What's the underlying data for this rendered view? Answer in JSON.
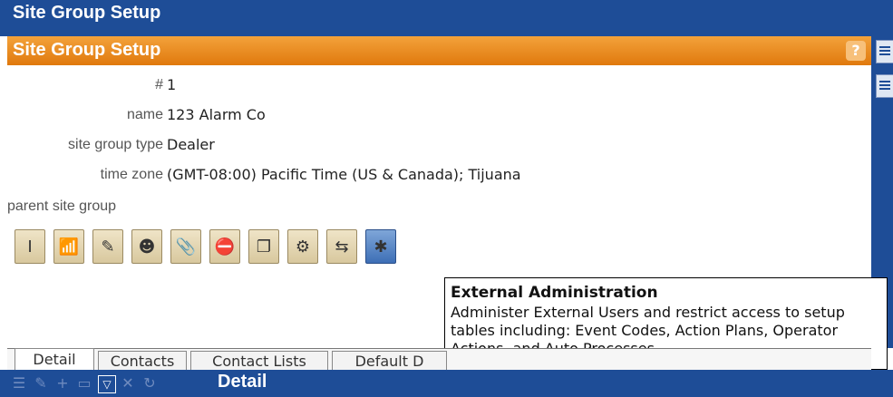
{
  "window": {
    "title": "Site Group Setup"
  },
  "panel": {
    "title": "Site Group Setup",
    "help_icon": "help-icon",
    "help_text": "?"
  },
  "fields": {
    "number": {
      "label": "#",
      "value": "1"
    },
    "name": {
      "label": "name",
      "value": "123 Alarm Co"
    },
    "site_group_type": {
      "label": "site group type",
      "value": "Dealer"
    },
    "time_zone": {
      "label": "time zone",
      "value": "(GMT-08:00) Pacific Time (US & Canada); Tijuana"
    },
    "parent_site_group": {
      "label": "parent site group",
      "value": ""
    }
  },
  "toolbar": {
    "buttons": [
      {
        "icon": "antenna-icon",
        "glyph": "Ⅰ"
      },
      {
        "icon": "signal-icon",
        "glyph": "📶"
      },
      {
        "icon": "notepad-icon",
        "glyph": "✎"
      },
      {
        "icon": "operator-icon",
        "glyph": "☻"
      },
      {
        "icon": "paperclip-icon",
        "glyph": "📎"
      },
      {
        "icon": "stop-icon",
        "glyph": "⛔"
      },
      {
        "icon": "copy-icon",
        "glyph": "❐"
      },
      {
        "icon": "hierarchy-icon",
        "glyph": "⚙"
      },
      {
        "icon": "transfer-icon",
        "glyph": "⇆"
      },
      {
        "icon": "external-admin-icon",
        "glyph": "✱"
      }
    ]
  },
  "tooltip": {
    "title": "External Administration",
    "description": "Administer External Users and restrict access to setup tables including: Event Codes, Action Plans, Operator Actions, and Auto Processes."
  },
  "tabs": [
    {
      "label": "Detail",
      "active": true
    },
    {
      "label": "Contacts",
      "active": false
    },
    {
      "label": "Contact Lists",
      "active": false
    },
    {
      "label": "Default D",
      "active": false
    }
  ],
  "bottombar": {
    "title": "Detail"
  }
}
